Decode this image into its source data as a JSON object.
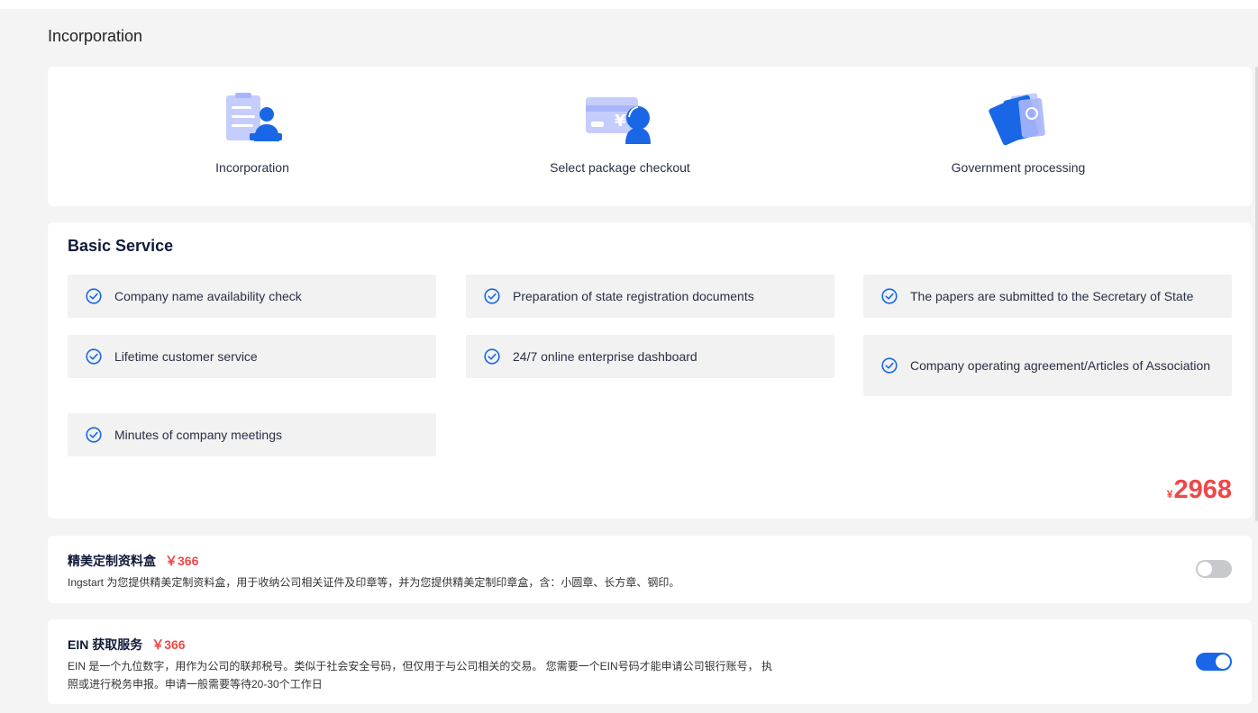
{
  "page": {
    "title": "Incorporation"
  },
  "steps": [
    {
      "label": "Incorporation",
      "icon": "incorporation-document-person-icon"
    },
    {
      "label": "Select package checkout",
      "icon": "package-checkout-card-yen-icon"
    },
    {
      "label": "Government processing",
      "icon": "government-processing-papers-icon"
    }
  ],
  "basic_service": {
    "title": "Basic Service",
    "features": [
      "Company name availability check",
      "Preparation of state registration documents",
      "The papers are submitted to the Secretary of State",
      "Lifetime customer service",
      "24/7 online enterprise dashboard",
      "Company operating agreement/Articles of Association",
      "Minutes of company meetings"
    ],
    "price_currency": "¥",
    "price_value": "2968"
  },
  "addons": [
    {
      "title": "精美定制资料盒",
      "price": "￥366",
      "description": "Ingstart 为您提供精美定制资料盒，用于收纳公司相关证件及印章等，并为您提供精美定制印章盒，含：小圆章、长方章、钢印。",
      "enabled": false
    },
    {
      "title": "EIN 获取服务",
      "price": "￥366",
      "description": "EIN 是一个九位数字，用作为公司的联邦税号。类似于社会安全号码，但仅用于与公司相关的交易。 您需要一个EIN号码才能申请公司银行账号， 执照或进行税务申报。申请一般需要等待20-30个工作日",
      "enabled": true
    }
  ],
  "colors": {
    "accent": "#1967e6",
    "price": "#f04747",
    "illustration_light": "#c5cdfd",
    "illustration_dark": "#1967e6"
  }
}
